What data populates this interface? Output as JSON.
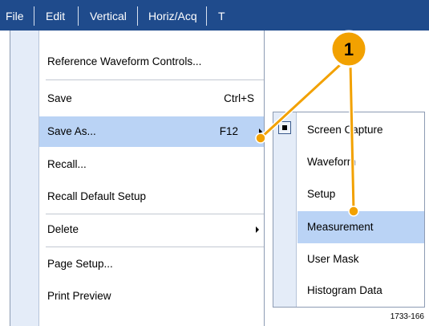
{
  "menubar": {
    "items": [
      {
        "label": "File"
      },
      {
        "label": "Edit"
      },
      {
        "label": "Vertical"
      },
      {
        "label": "Horiz/Acq"
      },
      {
        "label": "T"
      }
    ]
  },
  "file_menu": {
    "items": [
      {
        "label": "Reference Waveform Controls...",
        "shortcut": ""
      },
      {
        "label": "Save",
        "shortcut": "Ctrl+S"
      },
      {
        "label": "Save As...",
        "shortcut": "F12",
        "highlighted": true,
        "submenu": true
      },
      {
        "label": "Recall...",
        "shortcut": ""
      },
      {
        "label": "Recall Default Setup",
        "shortcut": ""
      },
      {
        "label": "Delete",
        "shortcut": "",
        "submenu": true
      },
      {
        "label": "Page Setup...",
        "shortcut": ""
      },
      {
        "label": "Print Preview",
        "shortcut": ""
      }
    ]
  },
  "save_as_submenu": {
    "items": [
      {
        "label": "Screen Capture",
        "checked": true
      },
      {
        "label": "Waveform"
      },
      {
        "label": "Setup"
      },
      {
        "label": "Measurement",
        "highlighted": true
      },
      {
        "label": "User Mask"
      },
      {
        "label": "Histogram Data"
      }
    ]
  },
  "callout": {
    "number": "1"
  },
  "figure_id": "1733-166",
  "colors": {
    "menubar_bg": "#1f4b8c",
    "highlight": "#bad3f5",
    "gutter": "#e4ecf8",
    "callout": "#f2a100"
  },
  "icons": [
    "submenu-arrow-icon",
    "check-indicator-icon",
    "callout-badge-icon"
  ]
}
